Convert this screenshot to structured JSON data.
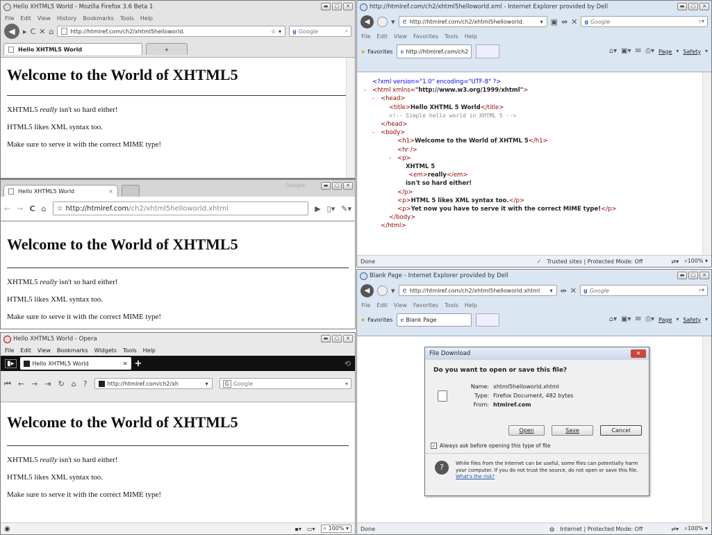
{
  "firefox": {
    "title": "Hello XHTML5 World - Mozilla Firefox 3.6 Beta 1",
    "menu": [
      "File",
      "Edit",
      "View",
      "History",
      "Bookmarks",
      "Tools",
      "Help"
    ],
    "url": "http://htmlref.com/ch2/xhtml5helloworld.",
    "search_placeholder": "Google",
    "tab_label": "Hello XHTML5 World",
    "new_tab": "+"
  },
  "chrome": {
    "tab_label": "Hello XHTML5 World",
    "brand": "Google",
    "url_host": "http://htmlref.com",
    "url_path": "/ch2/xhtml5helloworld.xhtml"
  },
  "opera": {
    "title": "Hello XHTML5 World - Opera",
    "menu": [
      "File",
      "Edit",
      "View",
      "Bookmarks",
      "Widgets",
      "Tools",
      "Help"
    ],
    "tab_label": "Hello XHTML5 World",
    "url": "http://htmlref.com/ch2/xh",
    "search_placeholder": "Google",
    "zoom": "100%"
  },
  "page": {
    "heading": "Welcome to the World of XHTML5",
    "p1_before": "XHTML5 ",
    "p1_em": "really",
    "p1_after": " isn't so hard either!",
    "p2": "HTML5 likes XML syntax too.",
    "p3": "Make sure to serve it with the correct MIME type!"
  },
  "ie_top": {
    "title": "http://htmlref.com/ch2/xhtml5helloworld.xml - Internet Explorer provided by Dell",
    "url": "http://htmlref.com/ch2/xhtml5helloworld.",
    "search_placeholder": "Google",
    "menu": [
      "File",
      "Edit",
      "View",
      "Favorites",
      "Tools",
      "Help"
    ],
    "favorites": "Favorites",
    "tab_label": "http://htmlref.com/ch2...",
    "cmd": [
      "Page",
      "Safety"
    ],
    "status_left": "Done",
    "status_zone": "Trusted sites | Protected Mode: Off",
    "zoom": "100%"
  },
  "xml": {
    "decl": "<?xml version=\"1.0\" encoding=\"UTF-8\" ?>",
    "html_open_a": "<html xmlns=",
    "html_open_b": "\"http://www.w3.org/1999/xhtml\"",
    "html_open_c": ">",
    "head_open": "<head>",
    "title_a": "<title>",
    "title_b": "Hello XHTML 5 World",
    "title_c": "</title>",
    "comment": "<!-- Simple hello world in XHTML 5 -->",
    "head_close": "</head>",
    "body_open": "<body>",
    "h1_a": "<h1>",
    "h1_b": "Welcome to the World of XHTML 5",
    "h1_c": "</h1>",
    "hr": "<hr />",
    "p_open": "<p>",
    "t1": "XHTML 5",
    "em_a": "<em>",
    "em_b": "really",
    "em_c": "</em>",
    "t2": "isn't so hard either!",
    "p_close": "</p>",
    "p2_a": "<p>",
    "p2_b": "HTML 5 likes XML syntax too.",
    "p2_c": "</p>",
    "p3_a": "<p>",
    "p3_b": "Yet now you have to serve it with the correct MIME type!",
    "p3_c": "</p>",
    "body_close": "</body>",
    "html_close": "</html>",
    "minus": "-"
  },
  "ie_bottom": {
    "title": "Blank Page - Internet Explorer provided by Dell",
    "url": "http://htmlref.com/ch2/xhtml5helloworld.xhtml",
    "search_placeholder": "Google",
    "menu": [
      "File",
      "Edit",
      "View",
      "Favorites",
      "Tools",
      "Help"
    ],
    "favorites": "Favorites",
    "tab_label": "Blank Page",
    "cmd": [
      "Page",
      "Safety"
    ],
    "status_left": "Done",
    "status_zone": "Internet | Protected Mode: Off",
    "zoom": "100%"
  },
  "dialog": {
    "title": "File Download",
    "question": "Do you want to open or save this file?",
    "name_label": "Name:",
    "name_value": "xhtml5helloworld.xhtml",
    "type_label": "Type:",
    "type_value": "Firefox Document, 482 bytes",
    "from_label": "From:",
    "from_value": "htmlref.com",
    "open": "Open",
    "save": "Save",
    "cancel": "Cancel",
    "checkbox": "Always ask before opening this type of file",
    "warning": "While files from the Internet can be useful, some files can potentially harm your computer. If you do not trust the source, do not open or save this file.",
    "risk_link": "What's the risk?"
  }
}
